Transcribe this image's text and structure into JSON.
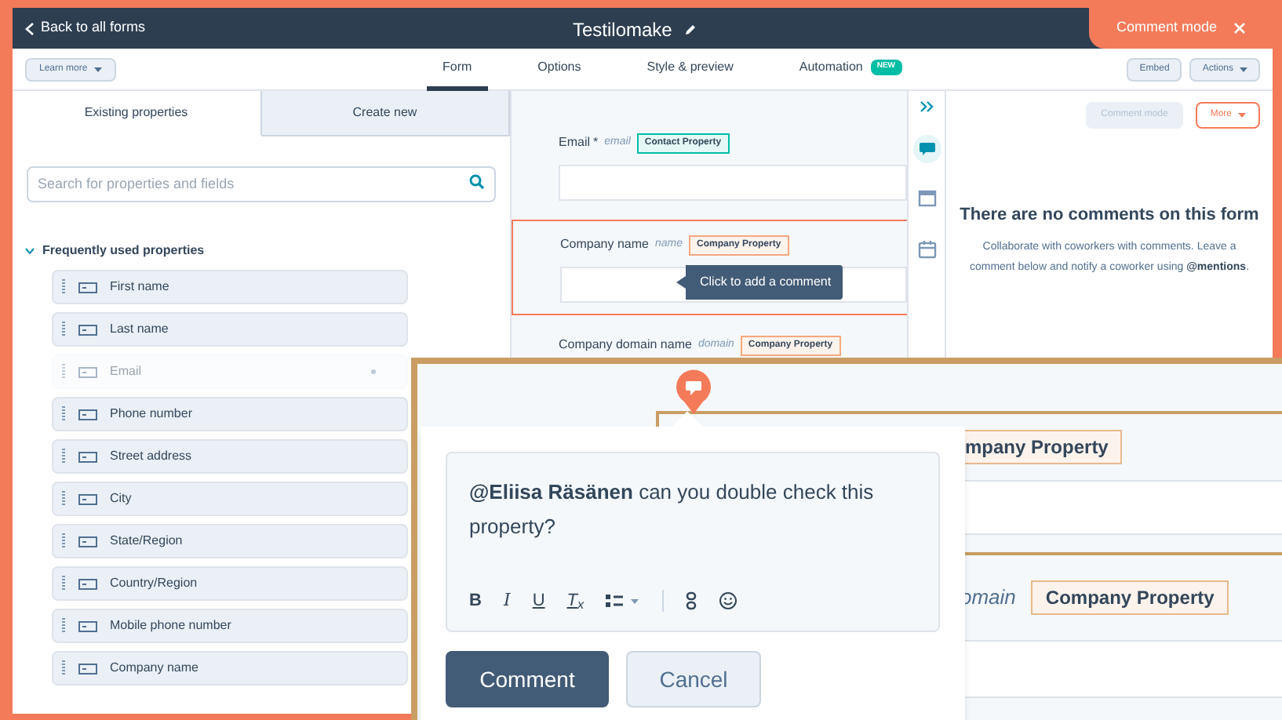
{
  "top_bar": {
    "back_link": "Back to all forms",
    "title": "Testilomake"
  },
  "comment_mode_tab": {
    "label": "Comment mode"
  },
  "toolbar": {
    "learn_more": "Learn more",
    "tabs": [
      {
        "label": "Form",
        "selected": true
      },
      {
        "label": "Options",
        "selected": false
      },
      {
        "label": "Style & preview",
        "selected": false
      },
      {
        "label": "Automation",
        "selected": false,
        "badge": "NEW"
      }
    ],
    "buttons": [
      "Embed",
      "Actions"
    ]
  },
  "properties_panel": {
    "tabs": [
      {
        "label": "Existing properties",
        "selected": true
      },
      {
        "label": "Create new",
        "selected": false
      }
    ],
    "search": {
      "placeholder": "Search for properties and fields"
    },
    "group": {
      "label": "Frequently used properties",
      "expanded": true,
      "items": [
        {
          "label": "First name",
          "disabled": false
        },
        {
          "label": "Last name",
          "disabled": false
        },
        {
          "label": "Email",
          "disabled": true
        },
        {
          "label": "Phone number",
          "disabled": false
        },
        {
          "label": "Street address",
          "disabled": false
        },
        {
          "label": "City",
          "disabled": false
        },
        {
          "label": "State/Region",
          "disabled": false
        },
        {
          "label": "Country/Region",
          "disabled": false
        },
        {
          "label": "Mobile phone number",
          "disabled": false
        },
        {
          "label": "Company name",
          "disabled": false
        }
      ]
    }
  },
  "form_preview": {
    "fields": [
      {
        "label": "Email",
        "required_mark": "*",
        "internal_name": "email",
        "badge": "Contact Property",
        "kind": "contact",
        "highlighted": false,
        "input": true
      },
      {
        "label": "Company name",
        "internal_name": "name",
        "badge": "Company Property",
        "kind": "company",
        "highlighted": true,
        "input": true
      },
      {
        "label": "Company domain name",
        "internal_name": "domain",
        "badge": "Company Property",
        "kind": "company",
        "highlighted": false,
        "input": false
      }
    ],
    "tooltip": "Click to add a comment"
  },
  "side_rail": [
    {
      "kind": "comments",
      "selected": true
    },
    {
      "kind": "preview",
      "selected": false
    },
    {
      "kind": "calendar",
      "selected": false
    }
  ],
  "comments_panel": {
    "buttons": [
      {
        "label": "Comment mode",
        "disabled": true
      },
      {
        "label": "More",
        "disabled": false
      }
    ],
    "heading": "There are no comments on this form",
    "message": "Collaborate with coworkers with comments. Leave a comment below and notify a coworker using **@mentions**."
  },
  "zoom_inset": {
    "badges": [
      "mpany Property",
      "Company Property"
    ],
    "domain_hint": "omain",
    "comment": {
      "text": "**@Eliisa Räsänen** can you double check this property?",
      "format_buttons": [
        {
          "kind": "bold",
          "label": "B"
        },
        {
          "kind": "italic",
          "label": "I"
        },
        {
          "kind": "underline",
          "label": "U"
        },
        {
          "kind": "clear",
          "label": "T$_{x}$"
        }
      ],
      "buttons": [
        "Comment",
        "Cancel"
      ]
    }
  }
}
